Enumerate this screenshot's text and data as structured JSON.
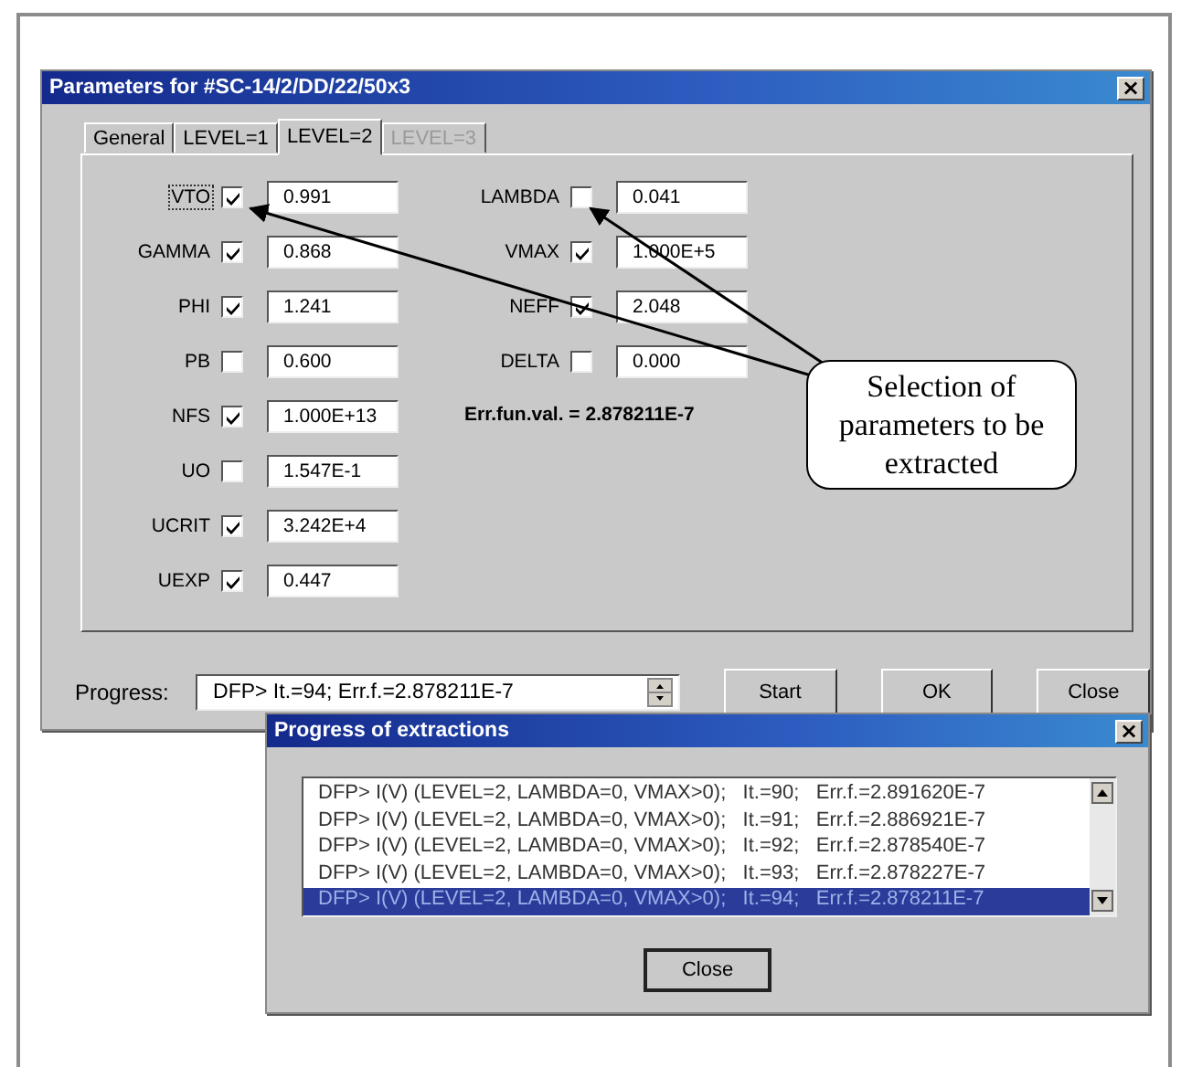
{
  "main_window": {
    "title": "Parameters for #SC-14/2/DD/22/50x3",
    "close_glyph": "×"
  },
  "tabs": [
    {
      "label": "General",
      "selected": false,
      "disabled": false
    },
    {
      "label": "LEVEL=1",
      "selected": false,
      "disabled": false
    },
    {
      "label": "LEVEL=2",
      "selected": true,
      "disabled": false
    },
    {
      "label": "LEVEL=3",
      "selected": false,
      "disabled": true
    }
  ],
  "parameters_left": [
    {
      "name": "VTO",
      "checked": true,
      "focused": true,
      "value": "0.991"
    },
    {
      "name": "GAMMA",
      "checked": true,
      "focused": false,
      "value": "0.868"
    },
    {
      "name": "PHI",
      "checked": true,
      "focused": false,
      "value": "1.241"
    },
    {
      "name": "PB",
      "checked": false,
      "focused": false,
      "value": "0.600"
    },
    {
      "name": "NFS",
      "checked": true,
      "focused": false,
      "value": "1.000E+13"
    },
    {
      "name": "UO",
      "checked": false,
      "focused": false,
      "value": "1.547E-1"
    },
    {
      "name": "UCRIT",
      "checked": true,
      "focused": false,
      "value": "3.242E+4"
    },
    {
      "name": "UEXP",
      "checked": true,
      "focused": false,
      "value": "0.447"
    }
  ],
  "parameters_right": [
    {
      "name": "LAMBDA",
      "checked": false,
      "focused": false,
      "value": "0.041"
    },
    {
      "name": "VMAX",
      "checked": true,
      "focused": false,
      "value": "1.000E+5"
    },
    {
      "name": "NEFF",
      "checked": true,
      "focused": false,
      "value": "2.048"
    },
    {
      "name": "DELTA",
      "checked": false,
      "focused": false,
      "value": "0.000"
    }
  ],
  "error_value": "Err.fun.val. = 2.878211E-7",
  "progress": {
    "label": "Progress:",
    "value": "DFP> It.=94; Err.f.=2.878211E-7"
  },
  "buttons": [
    "Start",
    "OK",
    "Close"
  ],
  "progress_window": {
    "title": "Progress of extractions",
    "close_glyph": "×",
    "rows": [
      {
        "text": "DFP> I(V) (LEVEL=2, LAMBDA=0, VMAX>0);   It.=90;   Err.f.=2.891620E-7",
        "selected": false
      },
      {
        "text": "DFP> I(V) (LEVEL=2, LAMBDA=0, VMAX>0);   It.=91;   Err.f.=2.886921E-7",
        "selected": false
      },
      {
        "text": "DFP> I(V) (LEVEL=2, LAMBDA=0, VMAX>0);   It.=92;   Err.f.=2.878540E-7",
        "selected": false
      },
      {
        "text": "DFP> I(V) (LEVEL=2, LAMBDA=0, VMAX>0);   It.=93;   Err.f.=2.878227E-7",
        "selected": false
      },
      {
        "text": "DFP> I(V) (LEVEL=2, LAMBDA=0, VMAX>0);   It.=94;   Err.f.=2.878211E-7",
        "selected": true
      }
    ],
    "button": "Close"
  },
  "callout": "Selection of parameters to be extracted"
}
